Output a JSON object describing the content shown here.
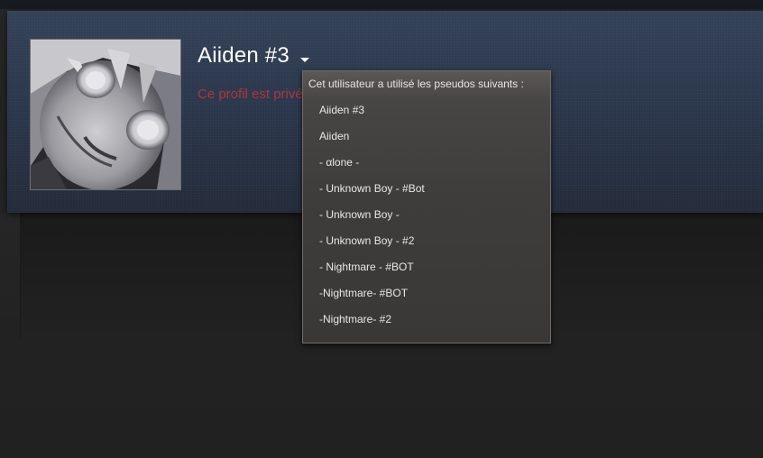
{
  "profile": {
    "persona_name": "Aiiden #3",
    "private_notice": "Ce profil est privé."
  },
  "alias_popup": {
    "header": "Cet utilisateur a utilisé les pseudos suivants :",
    "aliases": [
      "Aiiden #3",
      "Aiiden",
      "- αlone -",
      "- Unknown Boy - #Bot",
      "- Unknown Boy -",
      "- Unknown Boy - #2",
      "- Nightmare - #BOT",
      "-Nightmare- #BOT",
      "-Nightmare- #2"
    ]
  },
  "icons": {
    "dropdown": "chevron-down-icon"
  },
  "colors": {
    "private_text": "#b0343a",
    "header_background": "#2a364a",
    "popup_background": "#3f3d3b"
  }
}
